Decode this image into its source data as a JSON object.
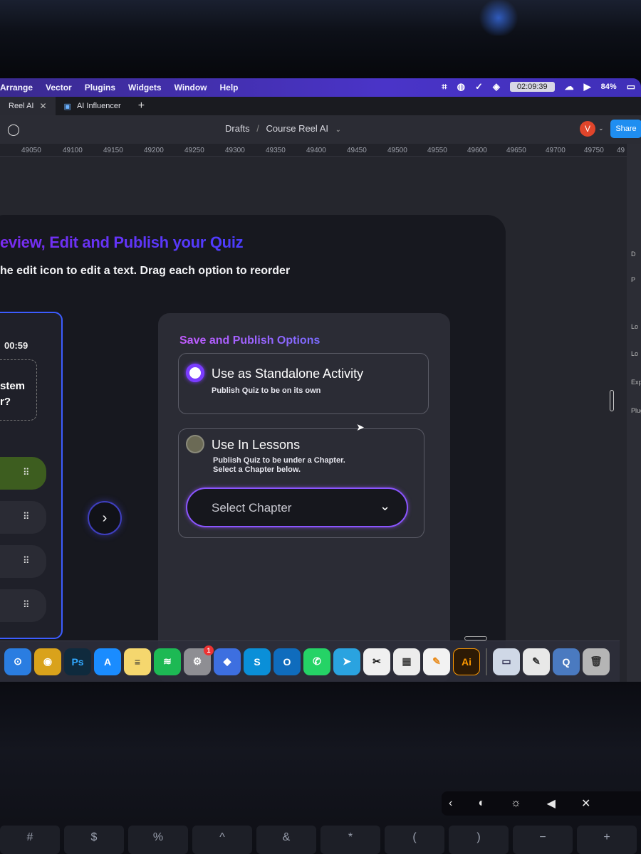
{
  "menubar": {
    "items": [
      "Arrange",
      "Vector",
      "Plugins",
      "Widgets",
      "Window",
      "Help"
    ],
    "clock": "02:09:39",
    "battery": "84%"
  },
  "tabs": [
    {
      "label": "Reel AI",
      "close": "✕"
    },
    {
      "label": "AI Influencer"
    }
  ],
  "tab_add": "+",
  "toolbar": {
    "crumb_root": "Drafts",
    "crumb_sep": "/",
    "crumb_file": "Course Reel AI",
    "avatar_letter": "V",
    "share_label": "Share"
  },
  "ruler": [
    "49050",
    "49100",
    "49150",
    "49200",
    "49250",
    "49300",
    "49350",
    "49400",
    "49450",
    "49500",
    "49550",
    "49600",
    "49650",
    "49700",
    "49750",
    "49"
  ],
  "right_panel": [
    "D",
    "P",
    "Lo",
    "Lo",
    "Exp",
    "Plug"
  ],
  "frame": {
    "title": "eview, Edit and Publish your Quiz",
    "subtitle": "he edit icon to edit a text. Drag each option to reorder"
  },
  "question": {
    "timer": "00:59",
    "text_line1": "stem",
    "text_line2": "r?",
    "drag_glyph": "⠿"
  },
  "publish": {
    "title": "Save and Publish Options",
    "standalone": {
      "title": "Use as Standalone Activity",
      "desc": "Publish Quiz to be on its own",
      "selected": true
    },
    "lessons": {
      "title": "Use In Lessons",
      "desc_line1": "Publish Quiz to be under a Chapter.",
      "desc_line2": "Select a Chapter below.",
      "selected": false
    },
    "select_placeholder": "Select Chapter"
  },
  "dock": {
    "apps": [
      {
        "name": "Safari",
        "glyph": "⊙",
        "color": "#2a7de1"
      },
      {
        "name": "Chrome",
        "glyph": "◉",
        "color": "#d9a21b"
      },
      {
        "name": "Photoshop",
        "glyph": "Ps",
        "color": "#0f2a3d"
      },
      {
        "name": "App Store",
        "glyph": "A",
        "color": "#1a8cff"
      },
      {
        "name": "Notes",
        "glyph": "≡",
        "color": "#f5d76e"
      },
      {
        "name": "Spotify",
        "glyph": "≋",
        "color": "#1db954"
      },
      {
        "name": "System Settings",
        "glyph": "⚙",
        "color": "#8e8e93"
      },
      {
        "name": "Windsurf",
        "glyph": "◆",
        "color": "#3d6fe0"
      },
      {
        "name": "Skype",
        "glyph": "S",
        "color": "#0a8fd8"
      },
      {
        "name": "Outlook",
        "glyph": "O",
        "color": "#0f6cbd"
      },
      {
        "name": "WhatsApp",
        "glyph": "✆",
        "color": "#25d366"
      },
      {
        "name": "Telegram",
        "glyph": "➤",
        "color": "#2aa3e0"
      },
      {
        "name": "CapCut",
        "glyph": "✂",
        "color": "#f0f0f0"
      },
      {
        "name": "Calculator",
        "glyph": "▦",
        "color": "#ececec"
      },
      {
        "name": "Pages",
        "glyph": "✎",
        "color": "#f2f2f2"
      },
      {
        "name": "Illustrator",
        "glyph": "Ai",
        "color": "#2d1a05"
      }
    ],
    "badge_count": "1",
    "right_apps": [
      {
        "name": "Preview",
        "glyph": "▭",
        "color": "#cfd8e6"
      },
      {
        "name": "TextEdit",
        "glyph": "✎",
        "color": "#e8e8e8"
      },
      {
        "name": "QuickTime",
        "glyph": "Q",
        "color": "#4a7ac0"
      },
      {
        "name": "Trash",
        "glyph": "🗑",
        "color": "#b5b5b5"
      }
    ]
  },
  "touchbar": [
    "‹",
    "◐",
    "☼",
    "◀",
    "✕"
  ],
  "keys": [
    "#",
    "$",
    "%",
    "^",
    "&",
    "*",
    "(",
    ")",
    "−",
    "+"
  ],
  "colors": {
    "accent_purple": "#7a3cff",
    "share_blue": "#1f8ef1",
    "frame_bg": "#17181f",
    "panel_bg": "#2b2c35"
  }
}
